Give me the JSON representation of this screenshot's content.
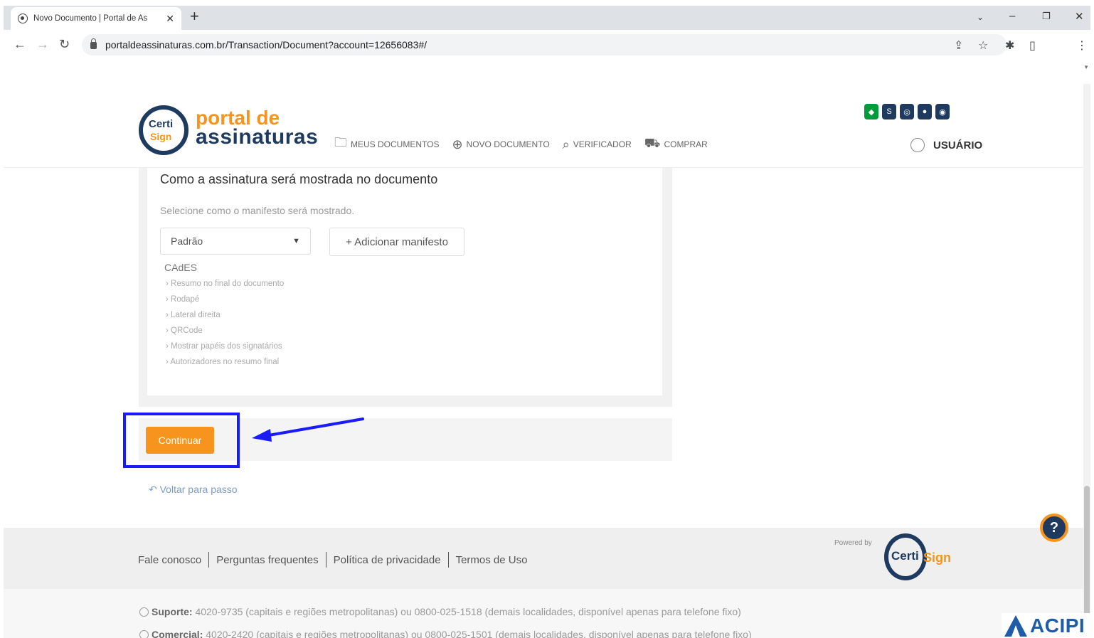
{
  "browser": {
    "tab_title": "Novo Documento | Portal de As",
    "url": "portaldeassinaturas.com.br/Transaction/Document?account=12656083#/"
  },
  "header": {
    "logo_badge_top": "Certi",
    "logo_badge_bottom": "Sign",
    "logo_line1": "portal de",
    "logo_line2": "assinaturas",
    "nav": [
      {
        "label": "MEUS DOCUMENTOS",
        "icon": "folder-icon"
      },
      {
        "label": "NOVO DOCUMENTO",
        "icon": "plus-circle-icon"
      },
      {
        "label": "VERIFICADOR",
        "icon": "search-icon"
      },
      {
        "label": "COMPRAR",
        "icon": "cart-icon"
      }
    ],
    "user_label": "USUÁRIO"
  },
  "card": {
    "title": "Como a assinatura será mostrada no documento",
    "subtitle": "Selecione como o manifesto será mostrado.",
    "select_value": "Padrão",
    "add_button": "+ Adicionar manifesto",
    "cades_title": "CAdES",
    "cades_items": [
      "Resumo no final do documento",
      "Rodapé",
      "Lateral direita",
      "QRCode",
      "Mostrar papéis dos signatários",
      "Autorizadores no resumo final"
    ]
  },
  "actions": {
    "continue_label": "Continuar",
    "back_label": "↶ Voltar para passo"
  },
  "footer": {
    "links": [
      "Fale conosco",
      "Perguntas frequentes",
      "Política de privacidade",
      "Termos de Uso"
    ],
    "powered_by": "Powered by",
    "brand_top": "Certi",
    "brand_bottom": "Sign",
    "support_label": "Suporte:",
    "support_text": "4020-9735 (capitais e regiões metropolitanas) ou 0800-025-1518 (demais localidades, disponível apenas para telefone fixo)",
    "commercial_label": "Comercial:",
    "commercial_text": "4020-2420 (capitais e regiões metropolitanas) ou 0800-025-1501 (demais localidades, disponível apenas para telefone fixo)"
  },
  "help_label": "?",
  "watermark": "ACIPI",
  "colors": {
    "accent": "#f7941d",
    "brand": "#1e3a5f",
    "highlight": "#1a1aff"
  }
}
